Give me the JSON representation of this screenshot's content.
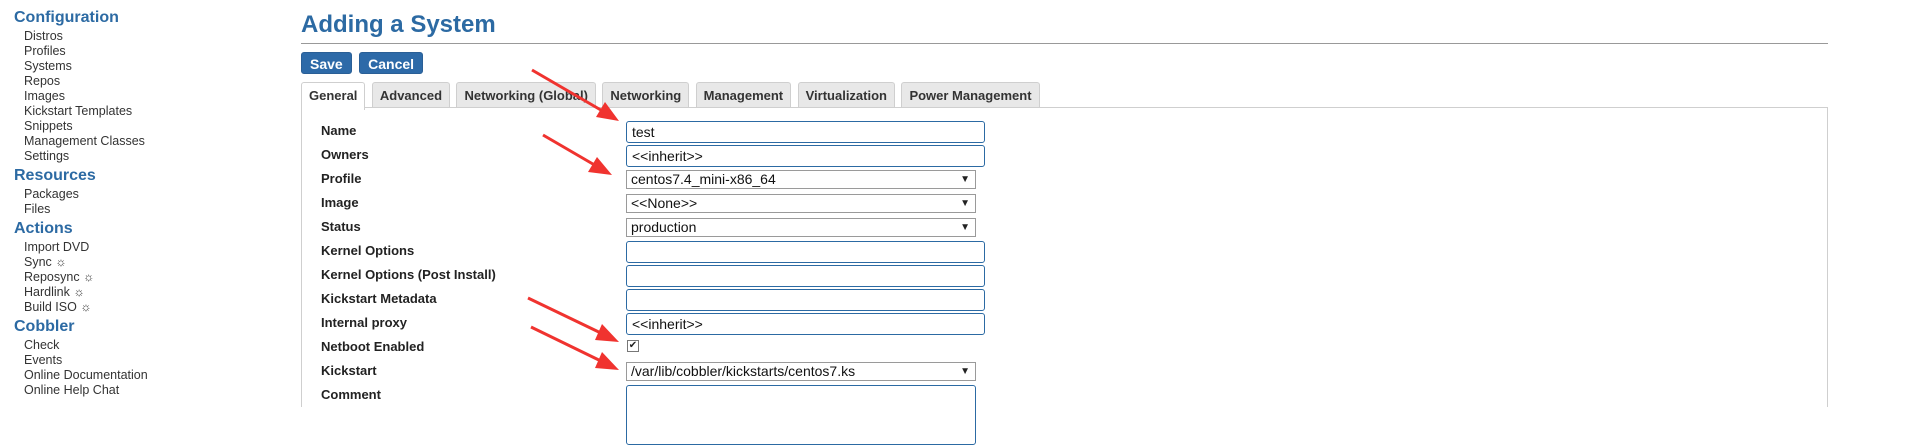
{
  "sidebar": {
    "sections": [
      {
        "heading": "Configuration",
        "items": [
          "Distros",
          "Profiles",
          "Systems",
          "Repos",
          "Images",
          "Kickstart Templates",
          "Snippets",
          "Management Classes",
          "Settings"
        ]
      },
      {
        "heading": "Resources",
        "items": [
          "Packages",
          "Files"
        ]
      },
      {
        "heading": "Actions",
        "items": [
          "Import DVD",
          "Sync ☼",
          "Reposync ☼",
          "Hardlink ☼",
          "Build ISO ☼"
        ]
      },
      {
        "heading": "Cobbler",
        "items": [
          "Check",
          "Events",
          "Online Documentation",
          "Online Help Chat"
        ]
      }
    ]
  },
  "page": {
    "title": "Adding a System"
  },
  "buttons": {
    "save": "Save",
    "cancel": "Cancel"
  },
  "tabs": [
    "General",
    "Advanced",
    "Networking (Global)",
    "Networking",
    "Management",
    "Virtualization",
    "Power Management"
  ],
  "form": {
    "name": {
      "label": "Name",
      "value": "test"
    },
    "owners": {
      "label": "Owners",
      "value": "<<inherit>>"
    },
    "profile": {
      "label": "Profile",
      "value": "centos7.4_mini-x86_64"
    },
    "image": {
      "label": "Image",
      "value": "<<None>>"
    },
    "status": {
      "label": "Status",
      "value": "production"
    },
    "kernel_options": {
      "label": "Kernel Options",
      "value": ""
    },
    "kernel_options_post": {
      "label": "Kernel Options (Post Install)",
      "value": ""
    },
    "kickstart_metadata": {
      "label": "Kickstart Metadata",
      "value": ""
    },
    "internal_proxy": {
      "label": "Internal proxy",
      "value": "<<inherit>>"
    },
    "netboot_enabled": {
      "label": "Netboot Enabled",
      "checked": true
    },
    "kickstart": {
      "label": "Kickstart",
      "value": "/var/lib/cobbler/kickstarts/centos7.ks"
    },
    "comment": {
      "label": "Comment",
      "value": ""
    }
  },
  "colors": {
    "accent": "#2c6aa3",
    "button": "#2d6aa8",
    "annotation_arrow": "#f0332f"
  }
}
